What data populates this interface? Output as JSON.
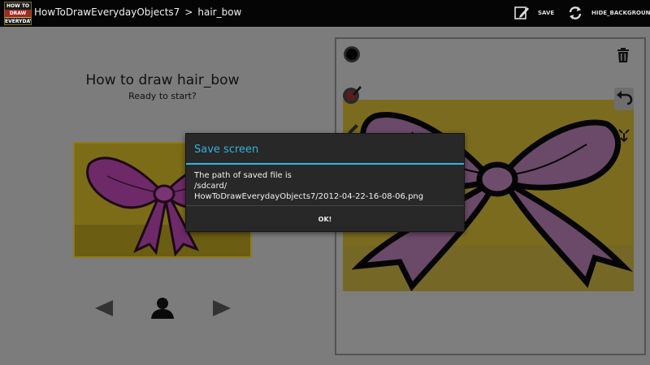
{
  "actionbar": {
    "logo_lines": [
      "HOW TO",
      "DRAW",
      "EVERYDAY"
    ],
    "app_name": "HowToDrawEverydayObjects7",
    "separator": ">",
    "current_item": "hair_bow",
    "save_label": "SAVE",
    "hide_bg_label": "HIDE_BACKGROUND"
  },
  "lesson": {
    "title": "How to draw hair_bow",
    "subtitle": "Ready to start?"
  },
  "dialog": {
    "title": "Save screen",
    "message_lines": [
      "The path of saved file is",
      "/sdcard/",
      "HowToDrawEverydayObjects7/2012-04-22-16-08-06.png"
    ],
    "ok_label": "OK!"
  },
  "colors": {
    "accent": "#33b5e5",
    "actionbar_bg": "#050505",
    "dim_background": "#7c7c7c",
    "dialog_bg": "#282828",
    "bow_fill_dimmed": "#6e3a66"
  },
  "icons": {
    "save": "pencil-edit-icon",
    "hide_background": "refresh-icon",
    "prev": "triangle-left-icon",
    "user": "person-icon",
    "next": "triangle-right-icon",
    "black_color": "black-dot-icon",
    "brush": "brush-icon",
    "pencil": "pencil-icon",
    "trash": "trash-icon",
    "undo": "undo-icon",
    "symmetry": "symmetry-icon"
  }
}
